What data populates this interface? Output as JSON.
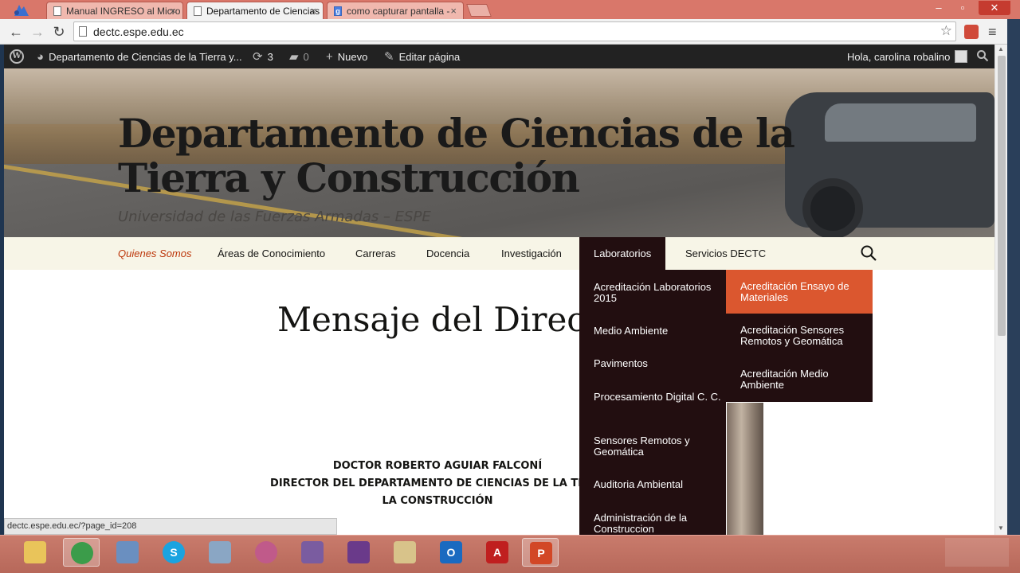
{
  "browser": {
    "tabs": [
      {
        "label": "Manual INGRESO al Micro",
        "close": "×"
      },
      {
        "label": "Departamento de Ciencias",
        "close": "×"
      },
      {
        "label": "como capturar pantalla - ",
        "close": "×"
      }
    ],
    "window_buttons": {
      "minimize": "–",
      "maximize": "▫",
      "close": "✕"
    },
    "nav": {
      "back": "←",
      "forward": "→",
      "reload": "↻"
    },
    "url": "dectc.espe.edu.ec",
    "bookmark_star": "☆",
    "menu_icon": "≡",
    "status_url": "dectc.espe.edu.ec/?page_id=208"
  },
  "adminbar": {
    "site_name": "Departamento de Ciencias de la Tierra y...",
    "updates_count": "3",
    "comments_count": "0",
    "new_label": "Nuevo",
    "edit_label": "Editar página",
    "greeting": "Hola, carolina robalino"
  },
  "header": {
    "title_line1": "Departamento de Ciencias de la",
    "title_line2": "Tierra y Construcción",
    "subtitle": "Universidad de las Fuerzas Armadas – ESPE"
  },
  "nav": {
    "items": [
      "Quienes Somos",
      "Áreas de Conocimiento",
      "Carreras",
      "Docencia",
      "Investigación",
      "Laboratorios",
      "Servicios DECTC"
    ],
    "current_item": "Quienes Somos",
    "hover_item": "Laboratorios"
  },
  "submenu": {
    "items": [
      "Acreditación Laboratorios 2015",
      "Medio Ambiente",
      "Pavimentos",
      "Procesamiento Digital C. C.",
      "Sensores Remotos y Geomática",
      "Auditoria Ambiental",
      "Administración de la Construccion"
    ]
  },
  "submenu2": {
    "items": [
      "Acreditación Ensayo de Materiales",
      "Acreditación Sensores Remotos y Geomática",
      "Acreditación Medio Ambiente"
    ],
    "active_item": "Acreditación Ensayo de Materiales"
  },
  "content": {
    "title": "Mensaje del Direc",
    "director_line1": "DOCTOR ROBERTO AGUIAR FALCONÍ",
    "director_line2": "DIRECTOR DEL DEPARTAMENTO DE CIENCIAS DE LA TIERR",
    "director_line3": "LA CONSTRUCCIÓN"
  },
  "taskbar": {
    "apps": [
      {
        "icon": "file-explorer-icon",
        "color": "#e9c45a"
      },
      {
        "icon": "chrome-icon",
        "color": "#3b9c4a"
      },
      {
        "icon": "network-icon",
        "color": "#6a8fc0"
      },
      {
        "icon": "skype-icon",
        "color": "#1aa3e0"
      },
      {
        "icon": "calculator-icon",
        "color": "#8aa6c4"
      },
      {
        "icon": "paint-icon",
        "color": "#c05a8a"
      },
      {
        "icon": "library-icon",
        "color": "#7a5ca0"
      },
      {
        "icon": "winrar-icon",
        "color": "#6a3a8a"
      },
      {
        "icon": "notepad-icon",
        "color": "#d8c38a"
      },
      {
        "icon": "outlook-icon",
        "color": "#1a6ac0"
      },
      {
        "icon": "autocad-icon",
        "color": "#c01f1f"
      },
      {
        "icon": "powerpoint-icon",
        "color": "#d24726"
      }
    ]
  }
}
